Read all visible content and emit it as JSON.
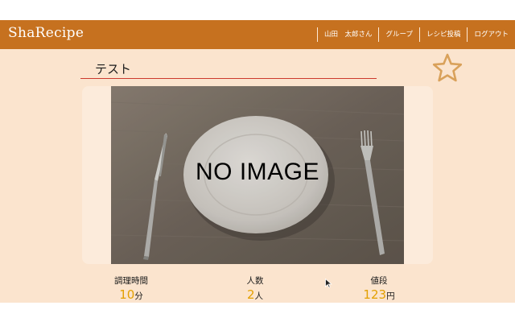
{
  "navbar": {
    "brand": "ShaRecipe",
    "links": [
      {
        "label": "山田　太郎さん"
      },
      {
        "label": "グループ"
      },
      {
        "label": "レシピ投稿"
      },
      {
        "label": "ログアウト"
      }
    ]
  },
  "recipe": {
    "title": "テスト",
    "image_placeholder": "NO IMAGE",
    "favorite_icon": "star-outline-icon"
  },
  "stats": [
    {
      "label": "調理時間",
      "value": "10",
      "unit": "分"
    },
    {
      "label": "人数",
      "value": "2",
      "unit": "人"
    },
    {
      "label": "値段",
      "value": "123",
      "unit": "円"
    }
  ],
  "colors": {
    "navbar": "#c6711f",
    "page_background": "#fbe4ce",
    "title_underline": "#cc3a2e",
    "star_outline": "#d9a15a",
    "stat_value": "#e3a000"
  }
}
